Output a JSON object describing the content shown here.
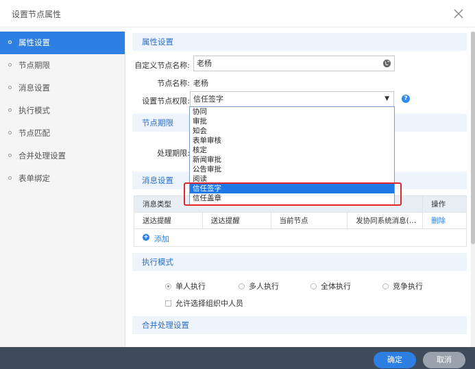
{
  "window": {
    "title": "设置节点属性"
  },
  "sidebar": {
    "items": [
      {
        "label": "属性设置"
      },
      {
        "label": "节点期限"
      },
      {
        "label": "消息设置"
      },
      {
        "label": "执行模式"
      },
      {
        "label": "节点匹配"
      },
      {
        "label": "合并处理设置"
      },
      {
        "label": "表单绑定"
      }
    ],
    "active_index": 0
  },
  "attr": {
    "heading": "属性设置",
    "custom_name_label": "自定义节点名称:",
    "custom_name_value": "老杨",
    "node_name_label": "节点名称:",
    "node_name_value": "老杨",
    "perm_label": "设置节点权限:",
    "perm_value": "信任签字"
  },
  "dropdown": {
    "options": [
      "协同",
      "审批",
      "知会",
      "表单审核",
      "核定",
      "新闻审批",
      "公告审批",
      "阅读",
      "信任签字",
      "信任盖章"
    ],
    "selected_index": 8
  },
  "deadline": {
    "heading": "节点期限",
    "process_label": "处理期限:"
  },
  "message": {
    "heading": "消息设置",
    "columns": [
      "消息类型",
      "操作"
    ],
    "rows": [
      {
        "type": "送达提醒",
        "c2": "送达提醒",
        "c3": "当前节点",
        "c4": "发协同系统消息(…",
        "op": "删除"
      }
    ],
    "add_label": "添加"
  },
  "exec": {
    "heading": "执行模式",
    "modes": [
      "单人执行",
      "多人执行",
      "全体执行",
      "竞争执行"
    ],
    "selected_index": 0,
    "allow_select_label": "允许选择组织中人员"
  },
  "merge": {
    "heading": "合并处理设置"
  },
  "footer": {
    "ok_label": "确定",
    "cancel_label": "取消"
  },
  "colors": {
    "accent": "#2d7fe3",
    "footer": "#3f4a5a",
    "highlight": "#e0262c"
  }
}
